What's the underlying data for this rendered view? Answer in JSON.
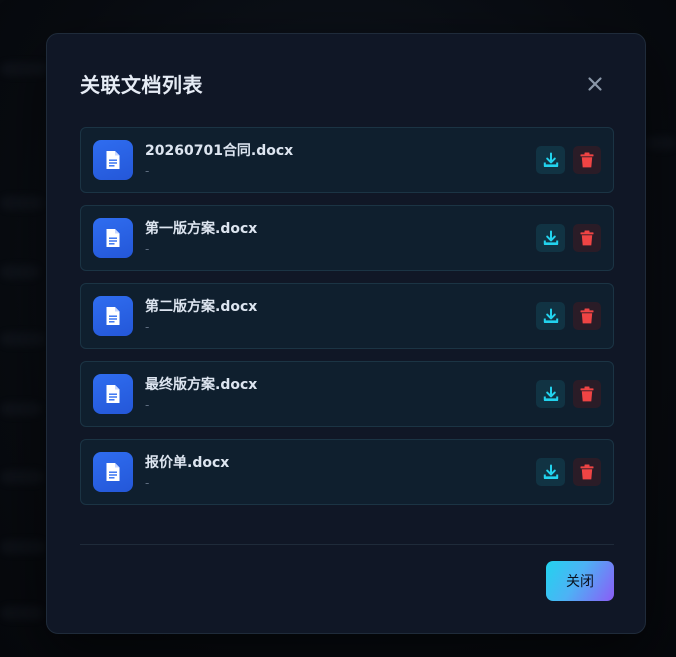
{
  "dialog": {
    "title": "关联文档列表",
    "close_button_label": "关闭"
  },
  "documents": [
    {
      "name": "20260701合同.docx",
      "meta": "-"
    },
    {
      "name": "第一版方案.docx",
      "meta": "-"
    },
    {
      "name": "第二版方案.docx",
      "meta": "-"
    },
    {
      "name": "最终版方案.docx",
      "meta": "-"
    },
    {
      "name": "报价单.docx",
      "meta": "-"
    }
  ],
  "icons": {
    "close": "close-icon",
    "file": "document-icon",
    "download": "download-icon",
    "delete": "trash-icon"
  },
  "colors": {
    "modal_bg": "#101726",
    "item_bg": "#0f1f2e",
    "file_icon_bg": "#2f6df0",
    "download": "#22d3ee",
    "delete": "#ef4444",
    "close_button_gradient_start": "#22d3ee",
    "close_button_gradient_end": "#8b5cf6"
  }
}
